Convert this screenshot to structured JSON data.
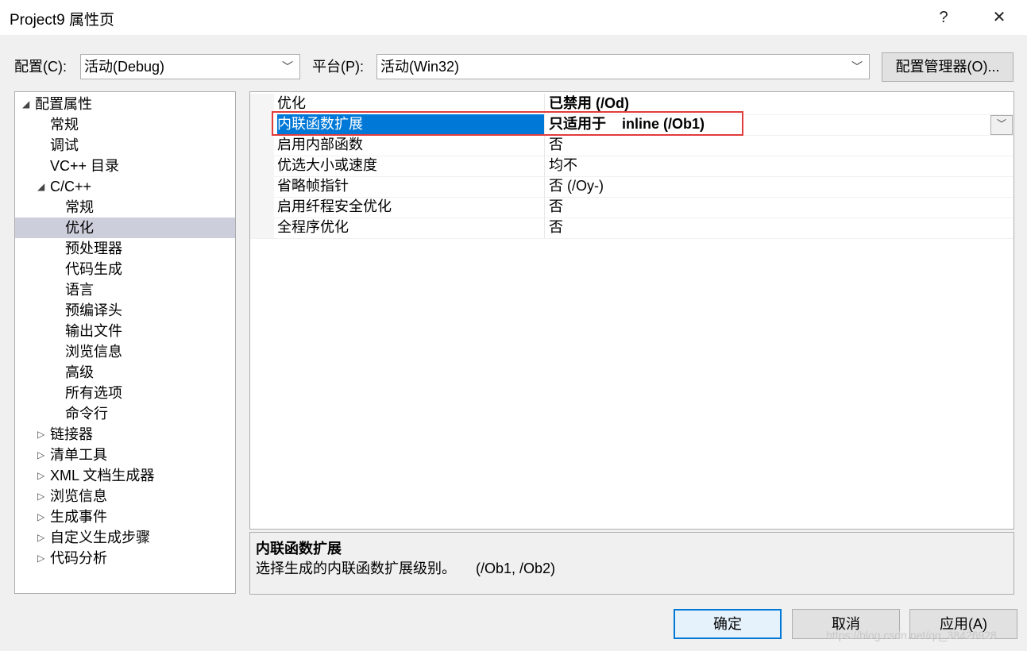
{
  "window": {
    "title": "Project9 属性页",
    "help_label": "?",
    "close_label": "✕"
  },
  "config_row": {
    "config_label": "配置(C):",
    "config_value": "活动(Debug)",
    "platform_label": "平台(P):",
    "platform_value": "活动(Win32)",
    "manager_button": "配置管理器(O)..."
  },
  "tree": {
    "items": [
      {
        "label": "配置属性",
        "glyph": "◢"
      },
      {
        "label": "常规"
      },
      {
        "label": "调试"
      },
      {
        "label": "VC++ 目录"
      },
      {
        "label": "C/C++",
        "glyph": "◢"
      },
      {
        "label": "常规"
      },
      {
        "label": "优化",
        "selected": true
      },
      {
        "label": "预处理器"
      },
      {
        "label": "代码生成"
      },
      {
        "label": "语言"
      },
      {
        "label": "预编译头"
      },
      {
        "label": "输出文件"
      },
      {
        "label": "浏览信息"
      },
      {
        "label": "高级"
      },
      {
        "label": "所有选项"
      },
      {
        "label": "命令行"
      },
      {
        "label": "链接器",
        "glyph": "▷"
      },
      {
        "label": "清单工具",
        "glyph": "▷"
      },
      {
        "label": "XML 文档生成器",
        "glyph": "▷"
      },
      {
        "label": "浏览信息",
        "glyph": "▷"
      },
      {
        "label": "生成事件",
        "glyph": "▷"
      },
      {
        "label": "自定义生成步骤",
        "glyph": "▷"
      },
      {
        "label": "代码分析",
        "glyph": "▷"
      }
    ]
  },
  "properties": [
    {
      "name": "优化",
      "value": "已禁用 (/Od)",
      "bold": true
    },
    {
      "name": "内联函数扩展",
      "value": "只适用于    inline (/Ob1)",
      "bold": true,
      "selected": true
    },
    {
      "name": "启用内部函数",
      "value": "否"
    },
    {
      "name": "优选大小或速度",
      "value": "均不"
    },
    {
      "name": "省略帧指针",
      "value": "否 (/Oy-)"
    },
    {
      "name": "启用纤程安全优化",
      "value": "否"
    },
    {
      "name": "全程序优化",
      "value": "否"
    }
  ],
  "description": {
    "title": "内联函数扩展",
    "text": "选择生成的内联函数扩展级别。     (/Ob1, /Ob2)"
  },
  "buttons": {
    "ok": "确定",
    "cancel": "取消",
    "apply": "应用(A)"
  },
  "icons": {
    "dropdown": "chevron-down-icon",
    "expanded": "expanded-triangle-icon",
    "collapsed": "collapsed-triangle-icon"
  },
  "watermark": "https://blog.csdn.net/qq_38426928"
}
